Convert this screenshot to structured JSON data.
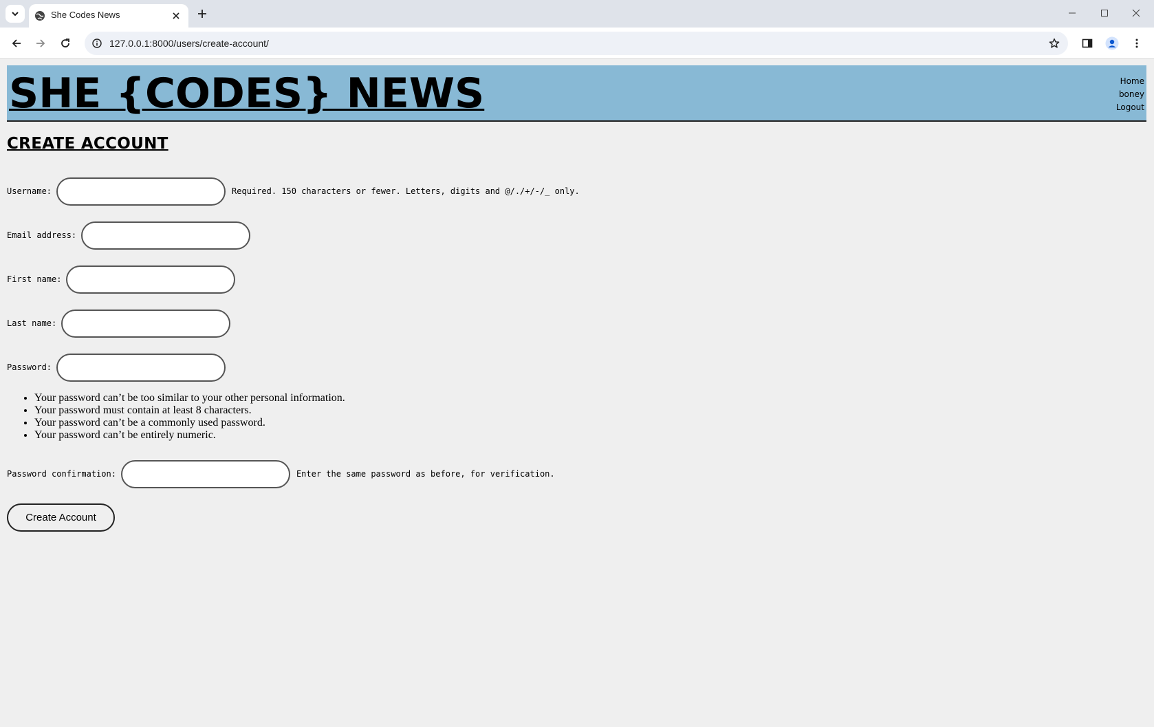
{
  "browser": {
    "tab_title": "She Codes News",
    "url": "127.0.0.1:8000/users/create-account/"
  },
  "header": {
    "site_title": "SHE {CODES} NEWS",
    "nav": {
      "home": "Home",
      "user": "boney",
      "logout": "Logout"
    }
  },
  "page": {
    "heading": "CREATE ACCOUNT"
  },
  "form": {
    "username_label": "Username:",
    "username_help": "Required. 150 characters or fewer. Letters, digits and @/./+/-/_ only.",
    "email_label": "Email address:",
    "first_name_label": "First name:",
    "last_name_label": "Last name:",
    "password_label": "Password:",
    "password_rules": [
      "Your password can’t be too similar to your other personal information.",
      "Your password must contain at least 8 characters.",
      "Your password can’t be a commonly used password.",
      "Your password can’t be entirely numeric."
    ],
    "password_confirm_label": "Password confirmation:",
    "password_confirm_help": "Enter the same password as before, for verification.",
    "submit_label": "Create Account"
  },
  "icons": {
    "tab_search": "chevron-down-icon",
    "favicon": "globe-icon",
    "tab_close": "close-icon",
    "new_tab": "plus-icon",
    "back": "back-arrow-icon",
    "forward": "forward-arrow-icon",
    "reload": "reload-icon",
    "site_info": "info-icon",
    "bookmark": "star-icon",
    "side_panel": "side-panel-icon",
    "profile": "profile-icon",
    "menu": "kebab-menu-icon"
  },
  "colors": {
    "header_bg": "#88b9d5",
    "page_bg": "#efefef",
    "chrome_bg": "#dfe3ea"
  }
}
